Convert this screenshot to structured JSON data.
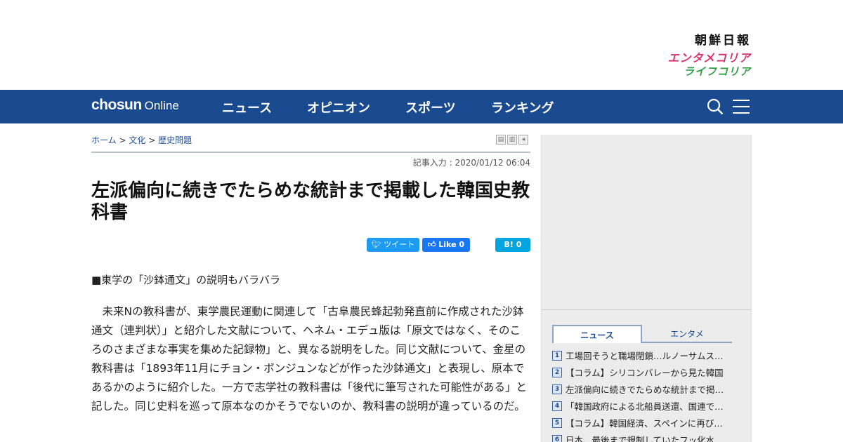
{
  "header": {
    "brand_main": "朝鮮日報",
    "brand_ent": "エンタメコリア",
    "brand_life": "ライフコリア"
  },
  "nav": {
    "logo_bold": "chosun",
    "logo_thin": "Online",
    "items": [
      {
        "label": "ニュース"
      },
      {
        "label": "オピニオン"
      },
      {
        "label": "スポーツ"
      },
      {
        "label": "ランキング"
      }
    ],
    "search_icon": "search-icon",
    "menu_icon": "hamburger-icon"
  },
  "breadcrumb": {
    "home": "ホーム",
    "sep": ">",
    "cat": "文化",
    "sub": "歴史問題"
  },
  "article": {
    "date": "記事入力 : 2020/01/12 06:04",
    "title": "左派偏向に続きでたらめな統計まで掲載した韓国史教科書",
    "subhead": "■東学の「沙鉢通文」の説明もバラバラ",
    "body": "未来Nの教科書が、東学農民運動に関連して「古阜農民蜂起勃発直前に作成された沙鉢通文（連判状）」と紹介した文献について、ヘネム・エデュ版は「原文ではなく、そのころのさまざまな事実を集めた記録物」と、異なる説明をした。同じ文献について、金星の教科書は「1893年11月にチョン・ボンジュンなどが作った沙鉢通文」と表現し、原本であるかのように紹介した。一方で志学社の教科書は「後代に筆写された可能性がある」と記した。同じ史料を巡って原本なのかそうでないのか、教科書の説明が違っているのだ。"
  },
  "share": {
    "tweet": "ツイート",
    "like": "Like 0",
    "hatena": "B! 0"
  },
  "sidebar": {
    "tab_news": "ニュース",
    "tab_ent": "エンタメ",
    "ranking": [
      {
        "n": "1",
        "t": "工場回そうと職場閉鎖…ルノーサムスンの組合員、..."
      },
      {
        "n": "2",
        "t": "【コラム】シリコンバレーから見た韓国"
      },
      {
        "n": "3",
        "t": "左派偏向に続きでたらめな統計まで掲載した韓国史教科書"
      },
      {
        "n": "4",
        "t": "「韓国政府による北船員送還、国連で問題化」"
      },
      {
        "n": "5",
        "t": "【コラム】韓国経済、スペインに再び追い越される..."
      },
      {
        "n": "6",
        "t": "日本、最後まで規制していたフッ化水素も..."
      }
    ]
  }
}
